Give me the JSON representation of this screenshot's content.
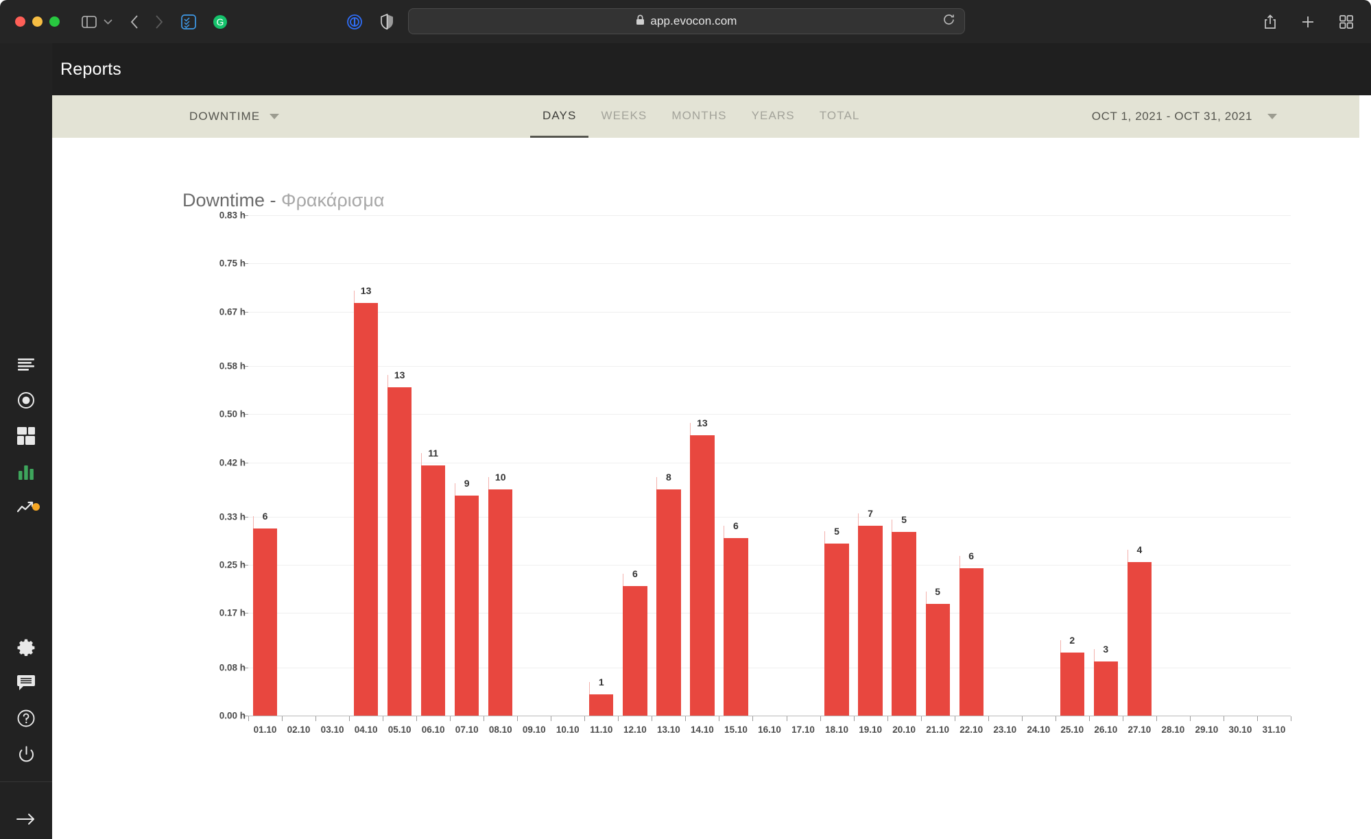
{
  "browser": {
    "url": "app.evocon.com",
    "lock_icon": "lock-icon",
    "reload_icon": "reload-icon",
    "share_icon": "share-icon",
    "new_tab_icon": "plus-icon",
    "tab_overview_icon": "tab-overview-icon",
    "sidebar_toggle_icon": "sidebar-toggle-icon",
    "back_icon": "back-chevron-icon",
    "forward_icon": "forward-chevron-icon",
    "extension_1_icon": "todoist-extension-icon",
    "extension_2_icon": "grammarly-extension-icon",
    "privacy_icon": "privacy-badger-icon",
    "shield_icon": "shield-icon"
  },
  "app_header": {
    "title": "Reports",
    "menu_icon": "hamburger-menu-icon"
  },
  "sidebar": {
    "items": [
      {
        "name": "sidebar-item-shiftlog",
        "icon": "list-lines-icon",
        "active": false
      },
      {
        "name": "sidebar-item-live",
        "icon": "target-circle-icon",
        "active": false
      },
      {
        "name": "sidebar-item-dashboard",
        "icon": "dashboard-grid-icon",
        "active": false
      },
      {
        "name": "sidebar-item-reports",
        "icon": "bar-chart-icon",
        "active": true
      },
      {
        "name": "sidebar-item-trends",
        "icon": "trending-up-icon",
        "active": false,
        "badge": true
      }
    ],
    "bottom_items": [
      {
        "name": "sidebar-item-settings",
        "icon": "gear-icon"
      },
      {
        "name": "sidebar-item-messages",
        "icon": "chat-bubble-icon"
      },
      {
        "name": "sidebar-item-help",
        "icon": "question-circle-icon"
      },
      {
        "name": "sidebar-item-logout",
        "icon": "power-icon"
      }
    ],
    "expand": {
      "name": "sidebar-expand-button",
      "icon": "arrow-right-icon"
    },
    "active_color": "#3ea65c",
    "badge_color": "#f5a623"
  },
  "toolbar": {
    "metric_label": "DOWNTIME",
    "metric_caret_icon": "chevron-down-icon",
    "tabs": [
      {
        "label": "DAYS",
        "active": true
      },
      {
        "label": "WEEKS",
        "active": false
      },
      {
        "label": "MONTHS",
        "active": false
      },
      {
        "label": "YEARS",
        "active": false
      },
      {
        "label": "TOTAL",
        "active": false
      }
    ],
    "date_range": "OCT 1, 2021 - OCT 31, 2021",
    "date_caret_icon": "chevron-down-icon",
    "background": "#e3e3d5"
  },
  "chart_data": {
    "type": "bar",
    "title": "Downtime - Φρακάρισμα",
    "title_prefix": "Downtime - ",
    "title_suffix": "Φρακάρισμα",
    "xlabel": "",
    "ylabel": "",
    "ylim": [
      0,
      0.83
    ],
    "grid": true,
    "legend": null,
    "bar_color": "#e8473f",
    "y_ticks": [
      "0.00 h",
      "0.08 h",
      "0.17 h",
      "0.25 h",
      "0.33 h",
      "0.42 h",
      "0.50 h",
      "0.58 h",
      "0.67 h",
      "0.75 h",
      "0.83 h"
    ],
    "y_tick_values": [
      0.0,
      0.08,
      0.17,
      0.25,
      0.33,
      0.42,
      0.5,
      0.58,
      0.67,
      0.75,
      0.83
    ],
    "categories": [
      "01.10",
      "02.10",
      "03.10",
      "04.10",
      "05.10",
      "06.10",
      "07.10",
      "08.10",
      "09.10",
      "10.10",
      "11.10",
      "12.10",
      "13.10",
      "14.10",
      "15.10",
      "16.10",
      "17.10",
      "18.10",
      "19.10",
      "20.10",
      "21.10",
      "22.10",
      "23.10",
      "24.10",
      "25.10",
      "26.10",
      "27.10",
      "28.10",
      "29.10",
      "30.10",
      "31.10"
    ],
    "values": [
      0.31,
      0,
      0,
      0.685,
      0.545,
      0.415,
      0.365,
      0.375,
      0,
      0,
      0.035,
      0.215,
      0.375,
      0.465,
      0.295,
      0,
      0,
      0.285,
      0.315,
      0.305,
      0.185,
      0.245,
      0,
      0,
      0.105,
      0.09,
      0.255,
      0,
      0,
      0,
      0
    ],
    "point_labels": [
      "6",
      "",
      "",
      "13",
      "13",
      "11",
      "9",
      "10",
      "",
      "",
      "1",
      "6",
      "8",
      "13",
      "6",
      "",
      "",
      "5",
      "7",
      "5",
      "5",
      "6",
      "",
      "",
      "2",
      "3",
      "4",
      "",
      "",
      "",
      ""
    ]
  }
}
